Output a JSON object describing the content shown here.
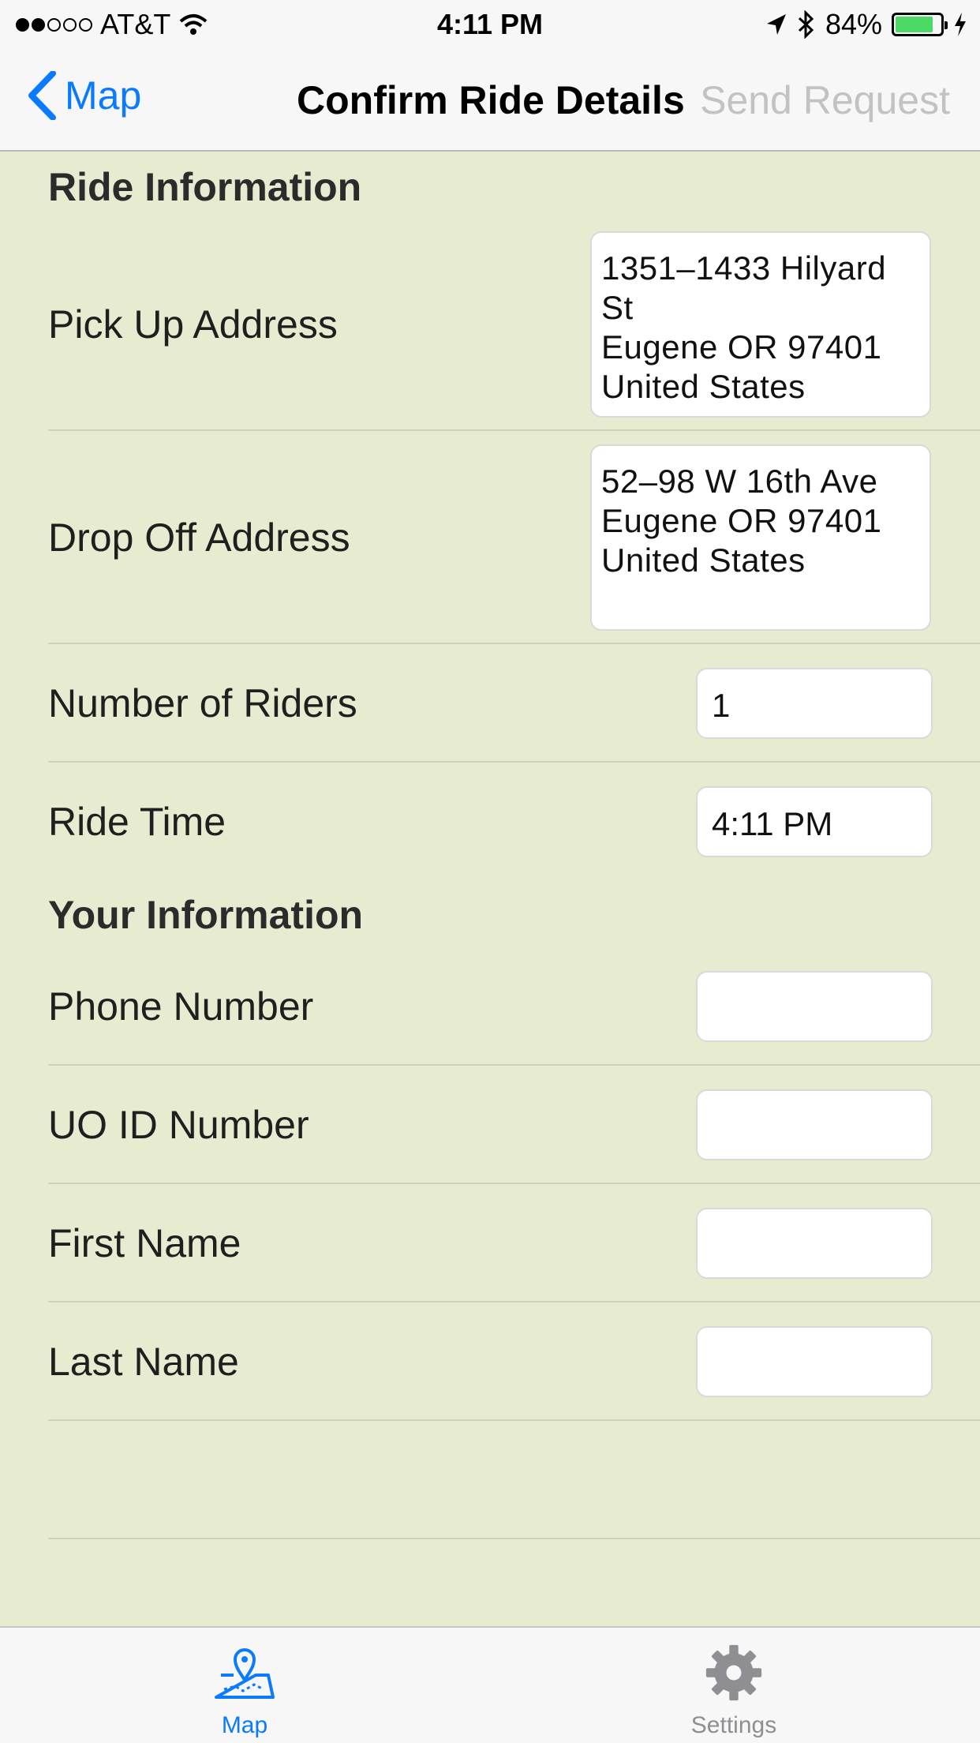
{
  "status_bar": {
    "carrier": "AT&T",
    "time": "4:11 PM",
    "battery": "84%",
    "battery_level": 0.84
  },
  "nav": {
    "back_label": "Map",
    "title": "Confirm Ride Details",
    "action_label": "Send Request"
  },
  "ride_section": {
    "title": "Ride Information",
    "pickup": {
      "label": "Pick Up Address",
      "value": "1351–1433  Hilyard St\nEugene OR 97401\nUnited States"
    },
    "dropoff": {
      "label": "Drop Off Address",
      "value": "52–98 W 16th Ave\nEugene OR 97401\nUnited States"
    },
    "riders": {
      "label": "Number of Riders",
      "value": "1"
    },
    "time": {
      "label": "Ride Time",
      "value": "4:11 PM"
    }
  },
  "your_section": {
    "title": "Your Information",
    "phone": {
      "label": "Phone Number",
      "value": ""
    },
    "uo_id": {
      "label": "UO ID Number",
      "value": ""
    },
    "first_name": {
      "label": "First Name",
      "value": ""
    },
    "last_name": {
      "label": "Last Name",
      "value": ""
    }
  },
  "tabbar": {
    "map_label": "Map",
    "settings_label": "Settings"
  },
  "colors": {
    "accent": "#0a7aff",
    "background": "#e7ebd0",
    "battery": "#4cd964"
  }
}
